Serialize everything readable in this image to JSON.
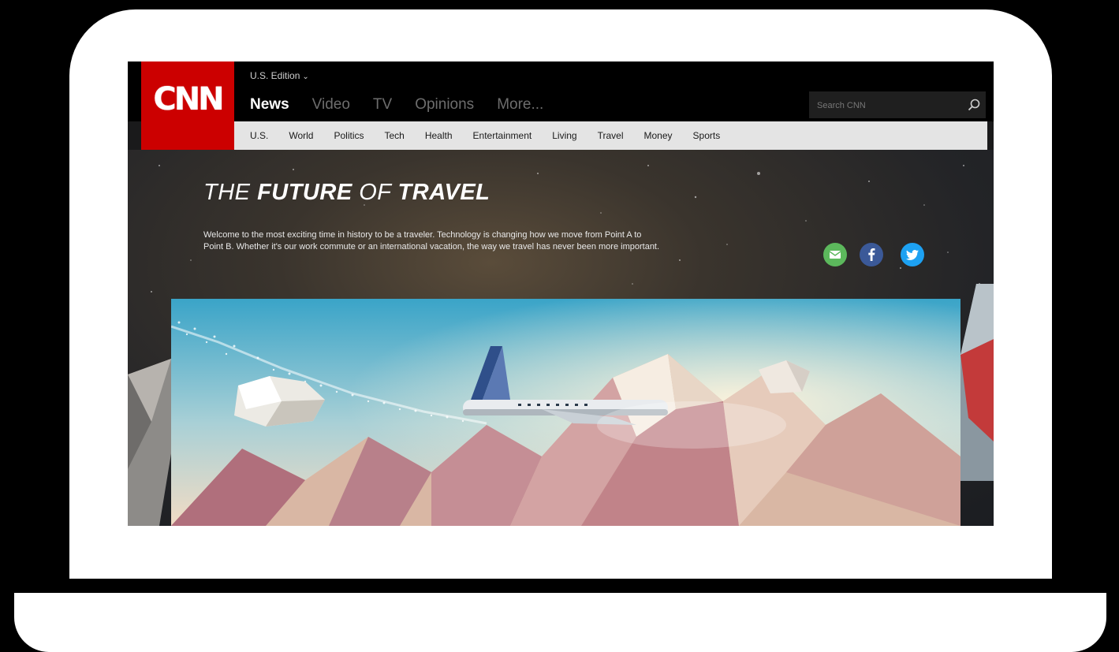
{
  "header": {
    "logo_text": "CNN",
    "edition_label": "U.S. Edition",
    "nav": [
      {
        "label": "News",
        "active": true
      },
      {
        "label": "Video",
        "active": false
      },
      {
        "label": "TV",
        "active": false
      },
      {
        "label": "Opinions",
        "active": false
      },
      {
        "label": "More...",
        "active": false
      }
    ],
    "search": {
      "placeholder": "Search CNN"
    }
  },
  "subnav": [
    "U.S.",
    "World",
    "Politics",
    "Tech",
    "Health",
    "Entertainment",
    "Living",
    "Travel",
    "Money",
    "Sports"
  ],
  "hero": {
    "title_prefix": "THE ",
    "title_strong_1": "FUTURE",
    "title_middle": " OF ",
    "title_strong_2": "TRAVEL",
    "description": "Welcome to the most exciting time in history to be a traveler. Technology is changing how we move from Point A to Point B. Whether it's our work commute or an international vacation, the way we travel has never been more important."
  },
  "share": [
    {
      "icon": "email-icon",
      "color": "#5cb85c"
    },
    {
      "icon": "facebook-icon",
      "color": "#3b5998"
    },
    {
      "icon": "twitter-icon",
      "color": "#1da1f2"
    }
  ],
  "colors": {
    "brand_red": "#cc0000",
    "subnav_bg": "#e4e4e4",
    "topbar_bg": "#000000"
  }
}
